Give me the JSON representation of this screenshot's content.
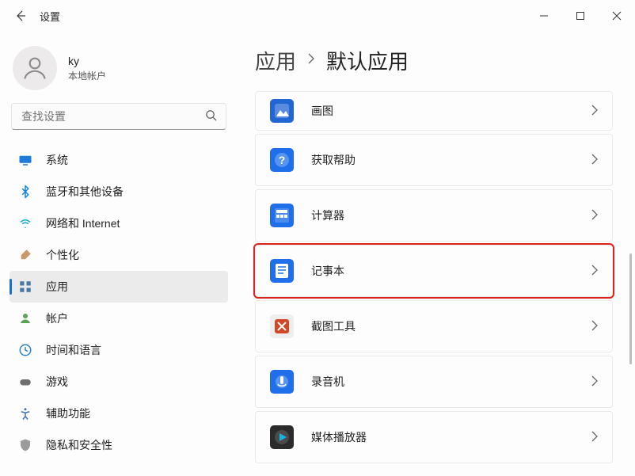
{
  "window": {
    "title": "设置"
  },
  "account": {
    "name": "ky",
    "subtitle": "本地帐户"
  },
  "search": {
    "placeholder": "查找设置"
  },
  "sidebar": {
    "items": [
      {
        "label": "系统",
        "icon": "display",
        "color": "#1d7cda"
      },
      {
        "label": "蓝牙和其他设备",
        "icon": "bluetooth",
        "color": "#0d88e1"
      },
      {
        "label": "网络和 Internet",
        "icon": "wifi",
        "color": "#0aa5e6"
      },
      {
        "label": "个性化",
        "icon": "brush",
        "color": "#c89a6a"
      },
      {
        "label": "应用",
        "icon": "apps",
        "color": "#4878a3",
        "active": true
      },
      {
        "label": "帐户",
        "icon": "person",
        "color": "#5aa457"
      },
      {
        "label": "时间和语言",
        "icon": "clock",
        "color": "#2c82c9"
      },
      {
        "label": "游戏",
        "icon": "gamepad",
        "color": "#6e6e6e"
      },
      {
        "label": "辅助功能",
        "icon": "accessibility",
        "color": "#3e73b4"
      },
      {
        "label": "隐私和安全性",
        "icon": "shield",
        "color": "#9b9b9b"
      }
    ]
  },
  "breadcrumb": {
    "parent": "应用",
    "current": "默认应用"
  },
  "apps": [
    {
      "label": "画图",
      "icon_bg": "#2266d3",
      "first": true
    },
    {
      "label": "获取帮助",
      "icon_bg": "#1f6feb"
    },
    {
      "label": "计算器",
      "icon_bg": "#1f6feb"
    },
    {
      "label": "记事本",
      "icon_bg": "#1f6feb",
      "highlight": true
    },
    {
      "label": "截图工具",
      "icon_bg": "#eeeeee"
    },
    {
      "label": "录音机",
      "icon_bg": "#1f6feb"
    },
    {
      "label": "媒体播放器",
      "icon_bg": "#2b2b2b"
    }
  ]
}
